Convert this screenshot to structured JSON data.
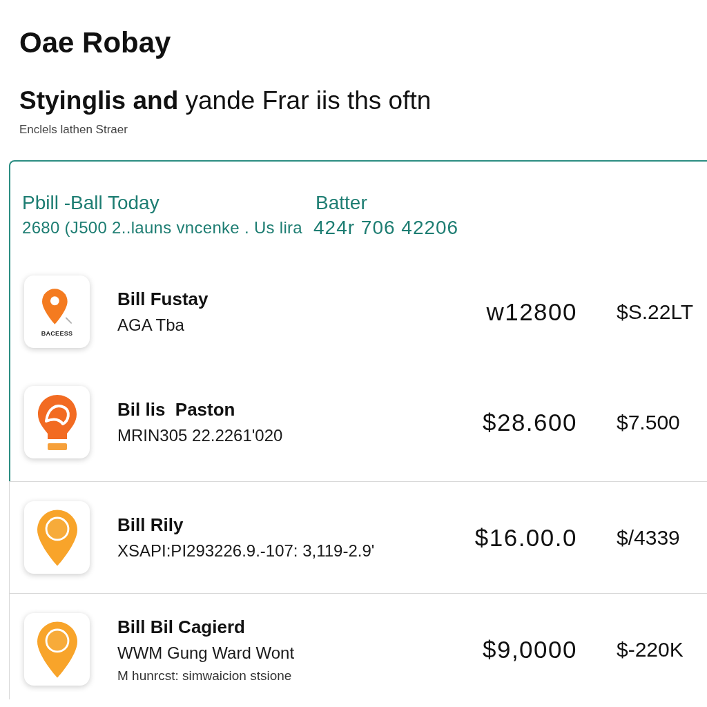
{
  "page": {
    "title": "Oae Robay",
    "heading": "**Styinglis and** yande Frar iis ths oftn",
    "subtitle": "Enclels lathen Straer"
  },
  "card": {
    "title": "Pbill -Ball Today",
    "column_label": "Batter",
    "summary": "2680 (J500 2..launs vncenke . Us lira",
    "total": "424r 706 42206",
    "rows": [
      {
        "kind": "pin",
        "icon_label": "BACEESS",
        "name": "Bill Fustay",
        "detail": "AGA Tba",
        "amount": "w12800",
        "secondary_amount": "$S.22LT"
      },
      {
        "kind": "bulb",
        "name": "Bil lis  Paston",
        "detail": "MRIN305 22.2261'020",
        "amount": "$28.600",
        "secondary_amount": "$7.500"
      }
    ]
  },
  "more_rows": [
    {
      "kind": "ring-pin",
      "name": "Bill Rily",
      "detail": "XSAPI:PI293226.9.-107: 3,119-2.9'",
      "amount": "$16.00.0",
      "secondary_amount": "$/4339"
    },
    {
      "kind": "ring-pin",
      "name": "Bill Bil Cagierd",
      "detail": "WWM Gung Ward Wont",
      "note": "M hunrcst: simwaicion stsione",
      "amount": "$9,0000",
      "secondary_amount": "$-220K"
    }
  ]
}
